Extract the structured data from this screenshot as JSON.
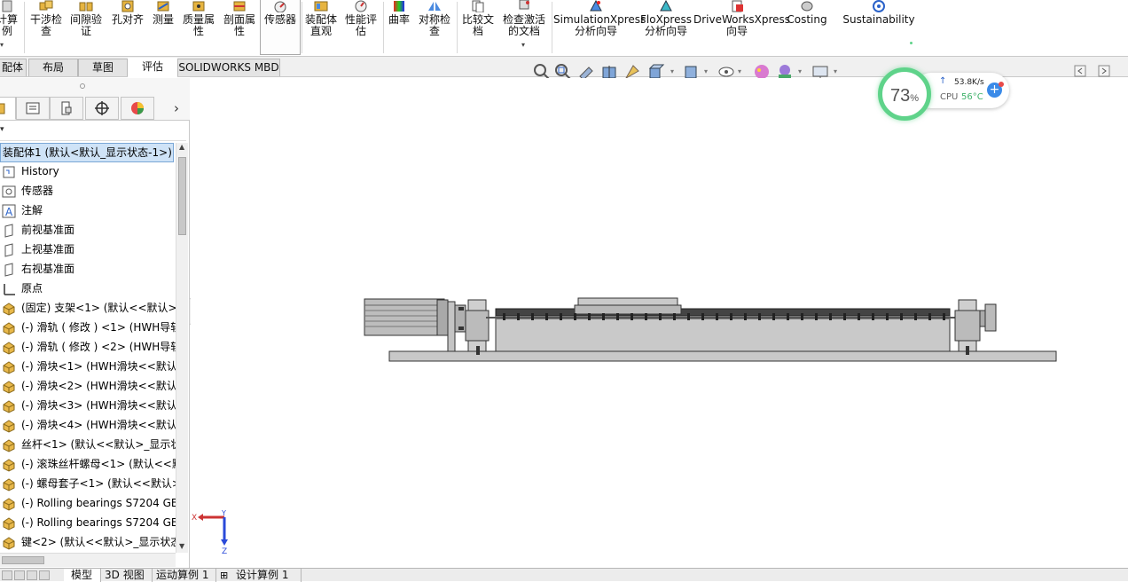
{
  "ribbon": {
    "items": [
      {
        "label": "计算\n例"
      },
      {
        "label": "干涉检\n查"
      },
      {
        "label": "间隙验\n证"
      },
      {
        "label": "孔对齐"
      },
      {
        "label": "测量"
      },
      {
        "label": "质量属\n性"
      },
      {
        "label": "剖面属\n性"
      },
      {
        "label": "传感器"
      },
      {
        "label": "装配体\n直观"
      },
      {
        "label": "性能评\n估"
      },
      {
        "label": "曲率"
      },
      {
        "label": "对称检\n查"
      },
      {
        "label": "比较文\n档"
      },
      {
        "label": "检查激活\n的文档"
      },
      {
        "label": "SimulationXpress\n分析向导"
      },
      {
        "label": "FloXpress\n分析向导"
      },
      {
        "label": "DriveWorksXpress\n向导"
      },
      {
        "label": "Costing"
      },
      {
        "label": "Sustainability"
      }
    ]
  },
  "tabs": [
    "配体",
    "布局",
    "草图",
    "评估",
    "SOLIDWORKS MBD"
  ],
  "tree": {
    "root": "装配体1 (默认<默认_显示状态-1>)",
    "items": [
      {
        "label": "History",
        "icon": "history-icon"
      },
      {
        "label": "传感器",
        "icon": "sensor-icon"
      },
      {
        "label": "注解",
        "icon": "annotation-icon"
      },
      {
        "label": "前视基准面",
        "icon": "plane-icon"
      },
      {
        "label": "上视基准面",
        "icon": "plane-icon"
      },
      {
        "label": "右视基准面",
        "icon": "plane-icon"
      },
      {
        "label": "原点",
        "icon": "origin-icon"
      },
      {
        "label": "(固定) 支架<1> (默认<<默认>_",
        "icon": "part-icon"
      },
      {
        "label": "(-) 滑轨 ( 修改 ) <1> (HWH导轨",
        "icon": "part-icon"
      },
      {
        "label": "(-) 滑轨 ( 修改 ) <2> (HWH导轨",
        "icon": "part-icon"
      },
      {
        "label": "(-) 滑块<1> (HWH滑块<<默认:",
        "icon": "part-icon"
      },
      {
        "label": "(-) 滑块<2> (HWH滑块<<默认:",
        "icon": "part-icon"
      },
      {
        "label": "(-) 滑块<3> (HWH滑块<<默认:",
        "icon": "part-icon"
      },
      {
        "label": "(-) 滑块<4> (HWH滑块<<默认:",
        "icon": "part-icon"
      },
      {
        "label": "丝杆<1> (默认<<默认>_显示状",
        "icon": "part-icon"
      },
      {
        "label": "(-) 滚珠丝杆螺母<1> (默认<<默",
        "icon": "part-icon"
      },
      {
        "label": "(-) 螺母套子<1> (默认<<默认>",
        "icon": "part-icon"
      },
      {
        "label": "(-) Rolling bearings S7204 GB",
        "icon": "part-icon"
      },
      {
        "label": "(-) Rolling bearings S7204 GB",
        "icon": "part-icon"
      },
      {
        "label": "键<2> (默认<<默认>_显示状态-",
        "icon": "part-icon"
      }
    ]
  },
  "bottom_tabs": [
    "模型",
    "3D 视图",
    "运动算例 1",
    "设计算例 1"
  ],
  "cpu_widget": {
    "percent": "73",
    "pct_sign": "%",
    "net_speed": "53.8K/s",
    "cpu_label": "CPU",
    "cpu_temp": "56°C"
  },
  "triad": {
    "x": "X",
    "y": "Y",
    "z": "Z"
  },
  "colors": {
    "accent_green": "#5fd38a",
    "selected_bg": "#cfe3f7",
    "part_yellow": "#e8b84a"
  }
}
